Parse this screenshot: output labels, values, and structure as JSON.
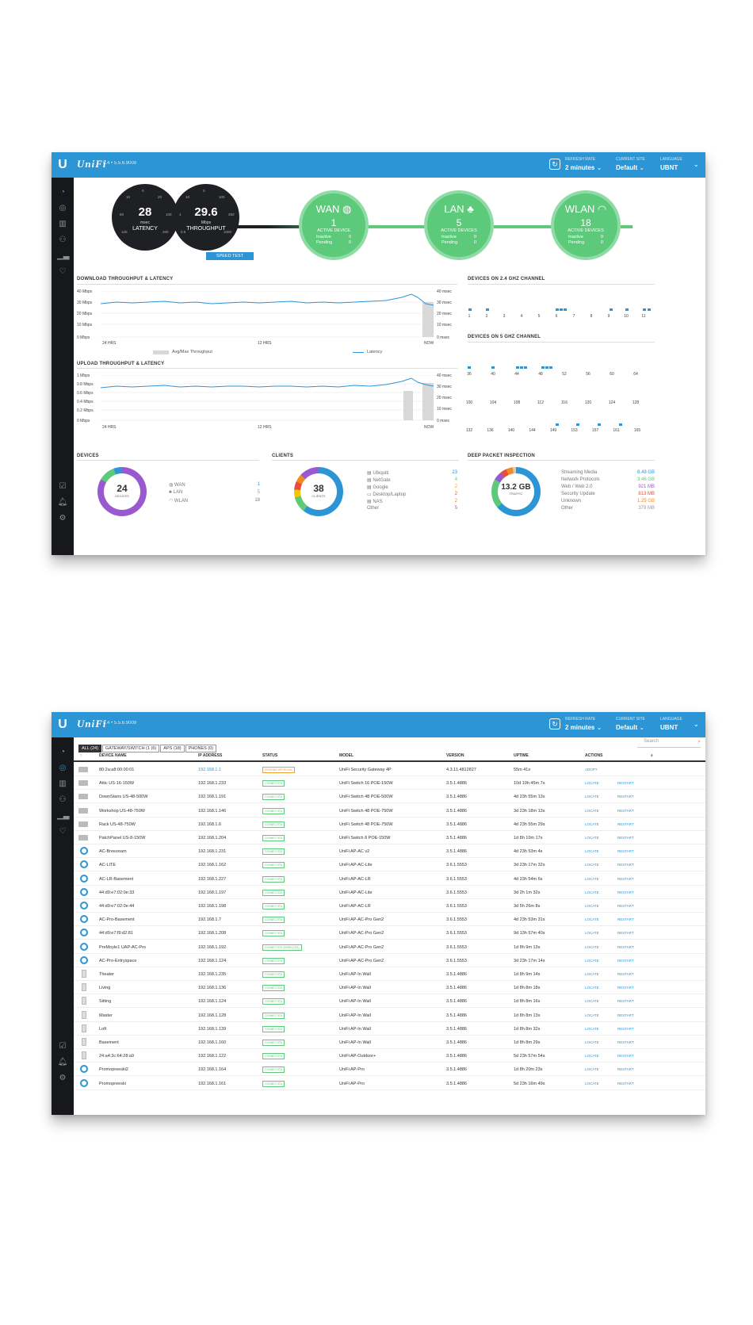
{
  "topbar": {
    "brand": "UniFi",
    "version": "5.4 • 5.5.6.9009",
    "refresh_label": "REFRESH RATE",
    "refresh_value": "2 minutes",
    "site_label": "CURRENT SITE",
    "site_value": "Default",
    "language_label": "LANGUAGE",
    "language_value": "UBNT"
  },
  "dashboard": {
    "latency": {
      "value": "28",
      "unit": "msec",
      "label": "LATENCY"
    },
    "throughput": {
      "value": "29.6",
      "sub": "MBPS",
      "unit": "Mbps",
      "label": "THROUGHPUT",
      "button": "SPEED TEST"
    },
    "wan": {
      "title": "WAN",
      "count": "1",
      "active_label": "ACTIVE DEVICE",
      "inactive_label": "Inactive",
      "inactive": "0",
      "pending_label": "Pending",
      "pending": "0"
    },
    "lan": {
      "title": "LAN",
      "count": "5",
      "active_label": "ACTIVE DEVICES",
      "inactive_label": "Inactive",
      "inactive": "0",
      "pending_label": "Pending",
      "pending": "0"
    },
    "wlan": {
      "title": "WLAN",
      "count": "18",
      "active_label": "ACTIVE DEVICES",
      "inactive_label": "Inactive",
      "inactive": "0",
      "pending_label": "Pending",
      "pending": "0"
    },
    "download_title": "DOWNLOAD THROUGHPUT & LATENCY",
    "upload_title": "UPLOAD THROUGHPUT & LATENCY",
    "download_left_axis": [
      "40 Mbps",
      "30 Mbps",
      "20 Mbps",
      "10 Mbps",
      "0 Mbps"
    ],
    "upload_left_axis": [
      "1 Mbps",
      "0.8 Mbps",
      "0.6 Mbps",
      "0.4 Mbps",
      "0.2 Mbps",
      "0 Mbps"
    ],
    "download_right_axis": [
      "40 msec",
      "30 msec",
      "20 msec",
      "10 msec",
      "0 msec"
    ],
    "upload_right_axis": [
      "40 msec",
      "30 msec",
      "20 msec",
      "10 msec",
      "0 msec"
    ],
    "x_labels": [
      "24 HRS",
      "12 HRS",
      "NOW"
    ],
    "legend_throughput": "Avg/Max Throughput",
    "legend_latency": "Latency",
    "ch24_title": "DEVICES ON 2.4 GHZ CHANNEL",
    "ch24": [
      "1",
      "2",
      "3",
      "4",
      "5",
      "6",
      "7",
      "8",
      "9",
      "10",
      "11"
    ],
    "ch5_title": "DEVICES ON 5 GHZ CHANNEL",
    "ch5_row1": [
      "36",
      "40",
      "44",
      "48",
      "52",
      "56",
      "60",
      "64"
    ],
    "ch5_row2": [
      "100",
      "104",
      "108",
      "112",
      "116",
      "120",
      "124",
      "128"
    ],
    "ch5_row3": [
      "132",
      "136",
      "140",
      "144",
      "149",
      "153",
      "157",
      "161",
      "165"
    ],
    "devices_title": "DEVICES",
    "devices_total": "24",
    "devices_sub": "DEVICES",
    "devices_list": [
      {
        "label": "WAN",
        "value": "1"
      },
      {
        "label": "LAN",
        "value": "5"
      },
      {
        "label": "WLAN",
        "value": "18"
      }
    ],
    "clients_title": "CLIENTS",
    "clients_total": "38",
    "clients_sub": "CLIENTS",
    "clients_list": [
      {
        "label": "Ubiquiti",
        "value": "23"
      },
      {
        "label": "NetGate",
        "value": "4"
      },
      {
        "label": "Google",
        "value": "2"
      },
      {
        "label": "Desktop/Laptop",
        "value": "2"
      },
      {
        "label": "NAS",
        "value": "2"
      },
      {
        "label": "Other",
        "value": "5"
      }
    ],
    "dpi_title": "DEEP PACKET INSPECTION",
    "dpi_total": "13.2 GB",
    "dpi_sub": "TRAFFIC",
    "dpi_list": [
      {
        "label": "Streaming Media",
        "value": "8.49 GB"
      },
      {
        "label": "Network Protocols",
        "value": "3.46 GB"
      },
      {
        "label": "Web / Web 2.0",
        "value": "921 MB"
      },
      {
        "label": "Security Update",
        "value": "813 MB"
      },
      {
        "label": "Unknown",
        "value": "1.25 GB"
      },
      {
        "label": "Other",
        "value": "379 MB"
      }
    ]
  },
  "devices_page": {
    "tabs": [
      "ALL (24)",
      "GATEWAY/SWITCH (1 (6)",
      "APS (18)",
      "PHONES (0)"
    ],
    "search_placeholder": "Search",
    "columns": [
      "DEVICE NAME",
      "IP ADDRESS",
      "STATUS",
      "MODEL",
      "VERSION",
      "UPTIME",
      "ACTIONS"
    ],
    "rows": [
      {
        "icon": "sw",
        "name": "80:2a:a8:00:00:01",
        "ip": "192.168.1.1",
        "status": "PENDING APPROVAL",
        "model": "UniFi Security Gateway 4P",
        "version": "4.3.11.4812827",
        "uptime": "55m 41s",
        "action1": "ADOPT",
        "action2": ""
      },
      {
        "icon": "sw",
        "name": "Attic US-16-150W",
        "ip": "192.168.1.233",
        "status": "CONNECTED",
        "model": "UniFi Switch 16 POE-150W",
        "version": "3.5.1.4886",
        "uptime": "10d 10h 45m 7s",
        "action1": "LOCATE",
        "action2": "RESTART"
      },
      {
        "icon": "sw",
        "name": "DownStairs US-48-500W",
        "ip": "192.168.1.191",
        "status": "CONNECTED",
        "model": "UniFi Switch 48 POE-500W",
        "version": "3.5.1.4886",
        "uptime": "4d 23h 55m 13s",
        "action1": "LOCATE",
        "action2": "RESTART"
      },
      {
        "icon": "sw",
        "name": "Workshop US-48-750W",
        "ip": "192.168.1.146",
        "status": "CONNECTED",
        "model": "UniFi Switch 48 POE-750W",
        "version": "3.5.1.4886",
        "uptime": "3d 23h 18m 13s",
        "action1": "LOCATE",
        "action2": "RESTART"
      },
      {
        "icon": "sw",
        "name": "Rack US-48-750W",
        "ip": "192.168.1.6",
        "status": "CONNECTED",
        "model": "UniFi Switch 48 POE-750W",
        "version": "3.5.1.4886",
        "uptime": "4d 23h 55m 29s",
        "action1": "LOCATE",
        "action2": "RESTART"
      },
      {
        "icon": "sw",
        "name": "PatchPanel US-8-150W",
        "ip": "192.168.1.204",
        "status": "CONNECTED",
        "model": "UniFi Switch 8 POE-150W",
        "version": "3.5.1.4886",
        "uptime": "1d 8h 10m 17s",
        "action1": "LOCATE",
        "action2": "RESTART"
      },
      {
        "icon": "ap",
        "name": "AC-Breezeam",
        "ip": "192.168.1.231",
        "status": "CONNECTED",
        "model": "UniFi AP-AC v2",
        "version": "3.5.1.4886",
        "uptime": "4d 23h 53m 4s",
        "action1": "LOCATE",
        "action2": "RESTART"
      },
      {
        "icon": "ap",
        "name": "AC-LITE",
        "ip": "192.168.1.162",
        "status": "CONNECTED",
        "model": "UniFi AP-AC-Lite",
        "version": "3.6.1.5553",
        "uptime": "3d 23h 17m 32s",
        "action1": "LOCATE",
        "action2": "RESTART"
      },
      {
        "icon": "ap",
        "name": "AC-LR-Basement",
        "ip": "192.168.1.227",
        "status": "CONNECTED",
        "model": "UniFi AP-AC-LR",
        "version": "3.6.1.5553",
        "uptime": "4d 23h 54m 6s",
        "action1": "LOCATE",
        "action2": "RESTART"
      },
      {
        "icon": "ap",
        "name": "44:d9:e7:02:0e:33",
        "ip": "192.168.1.197",
        "status": "CONNECTED",
        "model": "UniFi AP-AC-Lite",
        "version": "3.6.1.5553",
        "uptime": "3d 2h 1m 32s",
        "action1": "LOCATE",
        "action2": "RESTART"
      },
      {
        "icon": "ap",
        "name": "44:d9:e7:02:0e:44",
        "ip": "192.168.1.198",
        "status": "CONNECTED",
        "model": "UniFi AP-AC-LR",
        "version": "3.6.1.5553",
        "uptime": "3d 5h 26m 8s",
        "action1": "LOCATE",
        "action2": "RESTART"
      },
      {
        "icon": "ap",
        "name": "AC-Pro-Basement",
        "ip": "192.168.1.7",
        "status": "CONNECTED",
        "model": "UniFi AP-AC-Pro Gen2",
        "version": "3.6.1.5553",
        "uptime": "4d 23h 53m 31s",
        "action1": "LOCATE",
        "action2": "RESTART"
      },
      {
        "icon": "ap",
        "name": "44:d9:e7:f9:d2:81",
        "ip": "192.168.1.208",
        "status": "CONNECTED",
        "model": "UniFi AP-AC-Pro Gen2",
        "version": "3.6.1.5553",
        "uptime": "9d 13h 57m 40s",
        "action1": "LOCATE",
        "action2": "RESTART"
      },
      {
        "icon": "ap",
        "name": "PreMoyle1 UAP-AC-Pro",
        "ip": "192.168.1.192",
        "status": "CONNECTED (WIRELESS)",
        "model": "UniFi AP-AC-Pro Gen2",
        "version": "3.6.1.5553",
        "uptime": "1d 8h 9m 13s",
        "action1": "LOCATE",
        "action2": "RESTART"
      },
      {
        "icon": "ap",
        "name": "AC-Pro-Entryspace",
        "ip": "192.168.1.124",
        "status": "CONNECTED",
        "model": "UniFi AP-AC-Pro Gen2",
        "version": "3.6.1.5553",
        "uptime": "3d 23h 17m 14s",
        "action1": "LOCATE",
        "action2": "RESTART"
      },
      {
        "icon": "wall",
        "name": "Theater",
        "ip": "192.168.1.235",
        "status": "CONNECTED",
        "model": "UniFi AP-In Wall",
        "version": "3.5.1.4886",
        "uptime": "1d 8h 9m 14s",
        "action1": "LOCATE",
        "action2": "RESTART"
      },
      {
        "icon": "wall",
        "name": "Living",
        "ip": "192.168.1.136",
        "status": "CONNECTED",
        "model": "UniFi AP-In Wall",
        "version": "3.5.1.4886",
        "uptime": "1d 8h 8m 18s",
        "action1": "LOCATE",
        "action2": "RESTART"
      },
      {
        "icon": "wall",
        "name": "Sitting",
        "ip": "192.168.1.124",
        "status": "CONNECTED",
        "model": "UniFi AP-In Wall",
        "version": "3.5.1.4886",
        "uptime": "1d 8h 8m 16s",
        "action1": "LOCATE",
        "action2": "RESTART"
      },
      {
        "icon": "wall",
        "name": "Master",
        "ip": "192.168.1.128",
        "status": "CONNECTED",
        "model": "UniFi AP-In Wall",
        "version": "3.5.1.4886",
        "uptime": "1d 8h 8m 13s",
        "action1": "LOCATE",
        "action2": "RESTART"
      },
      {
        "icon": "wall",
        "name": "Loft",
        "ip": "192.168.1.139",
        "status": "CONNECTED",
        "model": "UniFi AP-In Wall",
        "version": "3.5.1.4886",
        "uptime": "1d 8h 8m 32s",
        "action1": "LOCATE",
        "action2": "RESTART"
      },
      {
        "icon": "wall",
        "name": "Basement",
        "ip": "192.168.1.160",
        "status": "CONNECTED",
        "model": "UniFi AP-In Wall",
        "version": "3.5.1.4886",
        "uptime": "1d 8h 8m 29s",
        "action1": "LOCATE",
        "action2": "RESTART"
      },
      {
        "icon": "wall",
        "name": "24:a4:3c:64:28:a9",
        "ip": "192.168.1.122",
        "status": "CONNECTED",
        "model": "UniFi AP-Outdoor+",
        "version": "3.5.1.4886",
        "uptime": "5d 23h 57m 54s",
        "action1": "LOCATE",
        "action2": "RESTART"
      },
      {
        "icon": "ap",
        "name": "Promopreeski2",
        "ip": "192.168.1.164",
        "status": "CONNECTED",
        "model": "UniFi AP-Pro",
        "version": "3.5.1.4886",
        "uptime": "1d 8h 20m 23s",
        "action1": "LOCATE",
        "action2": "RESTART"
      },
      {
        "icon": "ap",
        "name": "Promopreeski",
        "ip": "192.168.1.161",
        "status": "CONNECTED",
        "model": "UniFi AP-Pro",
        "version": "3.5.1.4886",
        "uptime": "5d 23h 16m 49s",
        "action1": "LOCATE",
        "action2": "RESTART"
      }
    ]
  }
}
